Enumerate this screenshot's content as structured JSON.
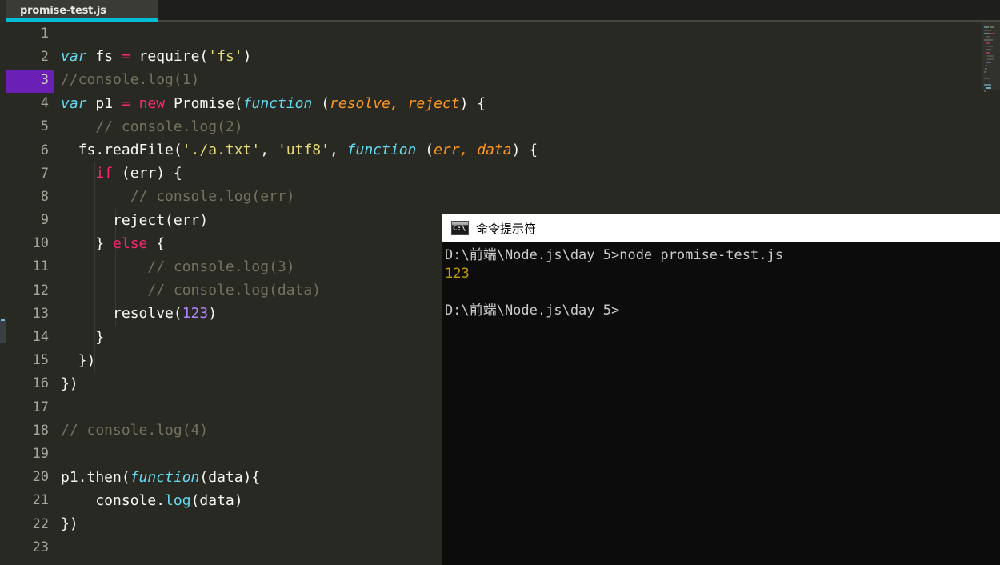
{
  "editor": {
    "tab": {
      "label": "promise-test.js",
      "active": true,
      "accent_color": "#00bcd4"
    },
    "theme": {
      "background": "#282923",
      "tabbar_background": "#1e1f1c",
      "current_line_highlight": "#6a1fb5",
      "gutter_text": "#a6a69b",
      "foreground": "#f8f8f2",
      "keyword": "#66d9ef",
      "control": "#f92672",
      "string": "#e6db74",
      "comment": "#75715e",
      "number": "#ae81ff",
      "parameter": "#fd971f"
    },
    "current_line": 3,
    "line_numbers": [
      "1",
      "2",
      "3",
      "4",
      "5",
      "6",
      "7",
      "8",
      "9",
      "10",
      "11",
      "12",
      "13",
      "14",
      "15",
      "16",
      "17",
      "18",
      "19",
      "20",
      "21",
      "22",
      "23"
    ],
    "lines": [
      {
        "n": "1",
        "text": ""
      },
      {
        "n": "2",
        "text": "var fs = require('fs')"
      },
      {
        "n": "3",
        "text": "//console.log(1)"
      },
      {
        "n": "4",
        "text": "var p1 = new Promise(function (resolve, reject) {"
      },
      {
        "n": "5",
        "text": "    // console.log(2)"
      },
      {
        "n": "6",
        "text": "  fs.readFile('./a.txt', 'utf8', function (err, data) {"
      },
      {
        "n": "7",
        "text": "    if (err) {"
      },
      {
        "n": "8",
        "text": "        // console.log(err)"
      },
      {
        "n": "9",
        "text": "      reject(err)"
      },
      {
        "n": "10",
        "text": "    } else {"
      },
      {
        "n": "11",
        "text": "          // console.log(3)"
      },
      {
        "n": "12",
        "text": "          // console.log(data)"
      },
      {
        "n": "13",
        "text": "      resolve(123)"
      },
      {
        "n": "14",
        "text": "    }"
      },
      {
        "n": "15",
        "text": "  })"
      },
      {
        "n": "16",
        "text": "})"
      },
      {
        "n": "17",
        "text": ""
      },
      {
        "n": "18",
        "text": "// console.log(4)"
      },
      {
        "n": "19",
        "text": ""
      },
      {
        "n": "20",
        "text": "p1.then(function(data){"
      },
      {
        "n": "21",
        "text": "    console.log(data)"
      },
      {
        "n": "22",
        "text": "})"
      },
      {
        "n": "23",
        "text": ""
      }
    ]
  },
  "terminal": {
    "title": "命令提示符",
    "icon_label": "C:\\",
    "lines": [
      {
        "text": "D:\\前端\\Node.js\\day 5>node promise-test.js",
        "kind": "prompt"
      },
      {
        "text": "123",
        "kind": "output"
      },
      {
        "text": "",
        "kind": "blank"
      },
      {
        "text": "D:\\前端\\Node.js\\day 5>",
        "kind": "prompt"
      }
    ]
  }
}
